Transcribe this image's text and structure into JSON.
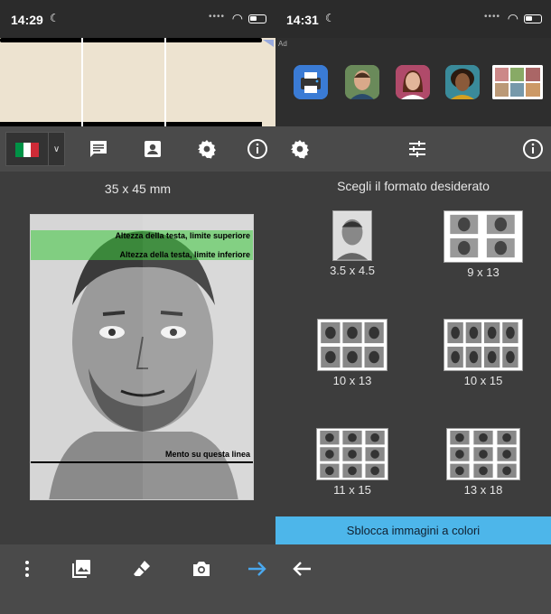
{
  "left": {
    "status": {
      "time": "14:29"
    },
    "toolbar": {
      "country": "Italia"
    },
    "dimension_label": "35 x 45 mm",
    "guides": {
      "top": "Altezza della testa, limite superiore",
      "bottom": "Altezza della testa, limite inferiore",
      "chin": "Mento su questa linea"
    }
  },
  "right": {
    "status": {
      "time": "14:31"
    },
    "ad_label": "Ad",
    "title": "Scegli il formato desiderato",
    "formats": [
      {
        "label": "3.5 x 4.5"
      },
      {
        "label": "9 x 13"
      },
      {
        "label": "10 x 13"
      },
      {
        "label": "10 x 15"
      },
      {
        "label": "11 x 15"
      },
      {
        "label": "13 x 18"
      }
    ],
    "unlock_button": "Sblocca immagini a colori"
  },
  "colors": {
    "accent": "#4db6ea",
    "guide_green": "#3cc83c",
    "flag_green": "#009246",
    "flag_white": "#ffffff",
    "flag_red": "#ce2b37",
    "arrow_blue": "#4aa8ee"
  }
}
